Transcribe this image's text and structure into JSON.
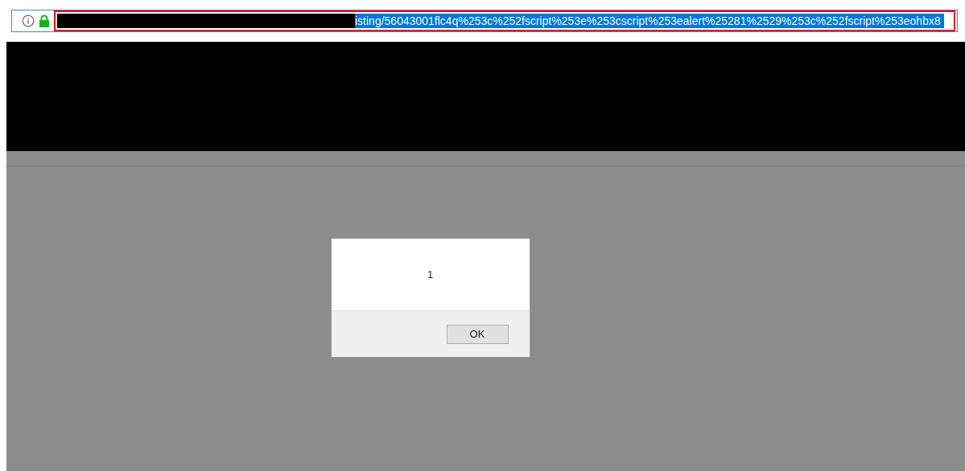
{
  "address_bar": {
    "url": "isting/56043001flc4q%253c%252fscript%253e%253cscript%253ealert%25281%2529%253c%252fscript%253eohbx8",
    "selected": true,
    "highlighted": true
  },
  "alert_dialog": {
    "message": "1",
    "buttons": [
      "OK"
    ]
  }
}
